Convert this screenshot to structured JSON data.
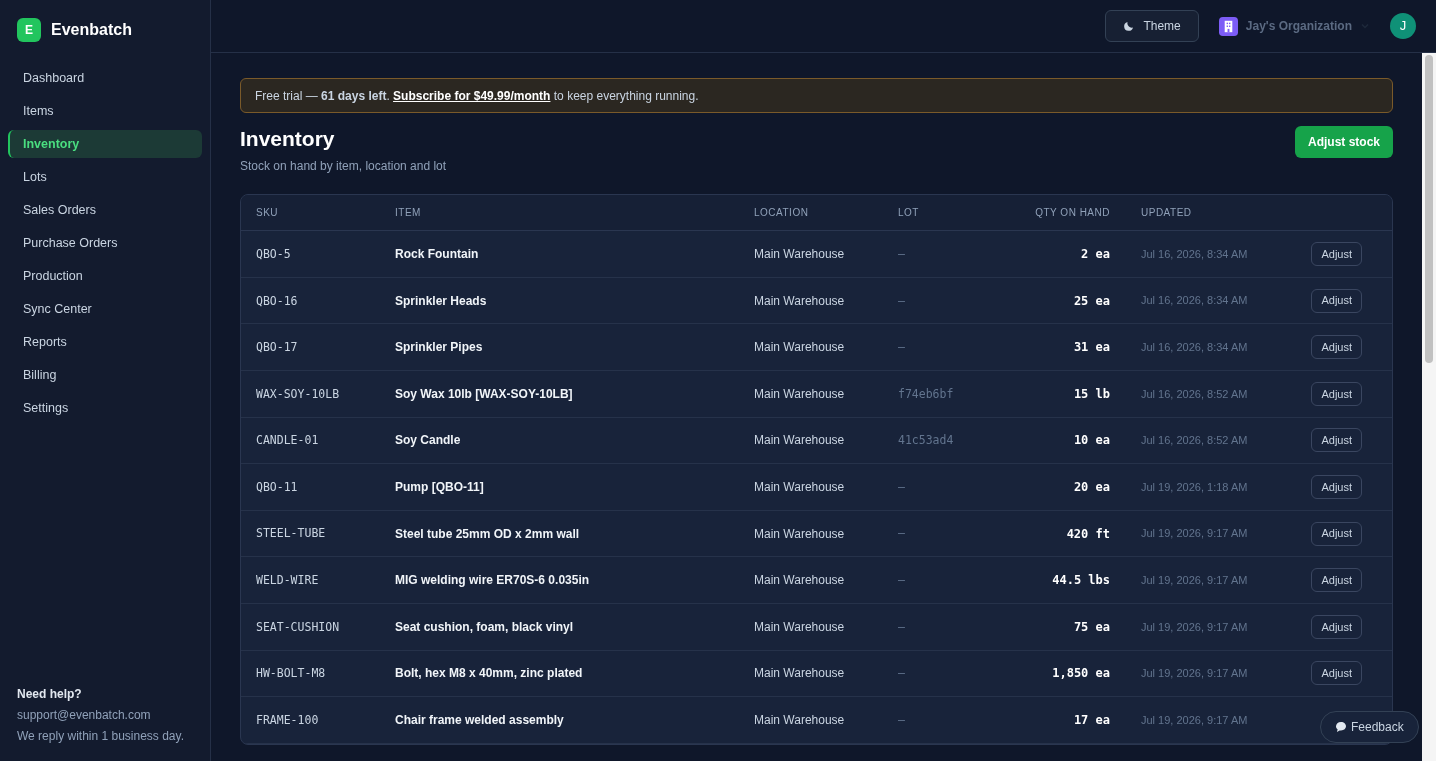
{
  "brand": {
    "logo_letter": "E",
    "name": "Evenbatch"
  },
  "nav": [
    {
      "label": "Dashboard",
      "selected": false
    },
    {
      "label": "Items",
      "selected": false
    },
    {
      "label": "Inventory",
      "selected": true
    },
    {
      "label": "Lots",
      "selected": false
    },
    {
      "label": "Sales Orders",
      "selected": false
    },
    {
      "label": "Purchase Orders",
      "selected": false
    },
    {
      "label": "Production",
      "selected": false
    },
    {
      "label": "Sync Center",
      "selected": false
    },
    {
      "label": "Reports",
      "selected": false
    },
    {
      "label": "Billing",
      "selected": false
    },
    {
      "label": "Settings",
      "selected": false
    }
  ],
  "help": {
    "title": "Need help?",
    "email": "support@evenbatch.com",
    "note": "We reply within 1 business day."
  },
  "header": {
    "theme_button": "Theme",
    "organization": "Jay's Organization",
    "avatar_letter": "J"
  },
  "banner": {
    "text": "Free trial — **61 days left**.",
    "link": "Subscribe for $49.99/month",
    "after": "to keep everything running."
  },
  "page": {
    "title": "Inventory",
    "subtitle": "Stock on hand by item, location and lot",
    "action": "Adjust stock"
  },
  "table": {
    "columns": [
      "SKU",
      "ITEM",
      "LOCATION",
      "LOT",
      "QTY ON HAND",
      "UPDATED"
    ],
    "rows": [
      {
        "sku": "QBO-5",
        "item": "Rock Fountain",
        "location": "Main Warehouse",
        "lot": "—",
        "qty": "2",
        "unit": "ea",
        "updated": "Jul 16, 2026, 8:34 AM",
        "action": "Adjust"
      },
      {
        "sku": "QBO-16",
        "item": "Sprinkler Heads",
        "location": "Main Warehouse",
        "lot": "—",
        "qty": "25",
        "unit": "ea",
        "updated": "Jul 16, 2026, 8:34 AM",
        "action": "Adjust"
      },
      {
        "sku": "QBO-17",
        "item": "Sprinkler Pipes",
        "location": "Main Warehouse",
        "lot": "—",
        "qty": "31",
        "unit": "ea",
        "updated": "Jul 16, 2026, 8:34 AM",
        "action": "Adjust"
      },
      {
        "sku": "WAX-SOY-10LB",
        "item": "Soy Wax 10lb [WAX-SOY-10LB]",
        "location": "Main Warehouse",
        "lot": "f74eb6bf",
        "qty": "15",
        "unit": "lb",
        "updated": "Jul 16, 2026, 8:52 AM",
        "action": "Adjust"
      },
      {
        "sku": "CANDLE-01",
        "item": "Soy Candle",
        "location": "Main Warehouse",
        "lot": "41c53ad4",
        "qty": "10",
        "unit": "ea",
        "updated": "Jul 16, 2026, 8:52 AM",
        "action": "Adjust"
      },
      {
        "sku": "QBO-11",
        "item": "Pump [QBO-11]",
        "location": "Main Warehouse",
        "lot": "—",
        "qty": "20",
        "unit": "ea",
        "updated": "Jul 19, 2026, 1:18 AM",
        "action": "Adjust"
      },
      {
        "sku": "STEEL-TUBE",
        "item": "Steel tube 25mm OD x 2mm wall",
        "location": "Main Warehouse",
        "lot": "—",
        "qty": "420",
        "unit": "ft",
        "updated": "Jul 19, 2026, 9:17 AM",
        "action": "Adjust"
      },
      {
        "sku": "WELD-WIRE",
        "item": "MIG welding wire ER70S-6 0.035in",
        "location": "Main Warehouse",
        "lot": "—",
        "qty": "44.5",
        "unit": "lbs",
        "updated": "Jul 19, 2026, 9:17 AM",
        "action": "Adjust"
      },
      {
        "sku": "SEAT-CUSHION",
        "item": "Seat cushion, foam, black vinyl",
        "location": "Main Warehouse",
        "lot": "—",
        "qty": "75",
        "unit": "ea",
        "updated": "Jul 19, 2026, 9:17 AM",
        "action": "Adjust"
      },
      {
        "sku": "HW-BOLT-M8",
        "item": "Bolt, hex M8 x 40mm, zinc plated",
        "location": "Main Warehouse",
        "lot": "—",
        "qty": "1,850",
        "unit": "ea",
        "updated": "Jul 19, 2026, 9:17 AM",
        "action": "Adjust"
      },
      {
        "sku": "FRAME-100",
        "item": "Chair frame welded assembly",
        "location": "Main Warehouse",
        "lot": "—",
        "qty": "17",
        "unit": "ea",
        "updated": "Jul 19, 2026, 9:17 AM"
      }
    ]
  },
  "feedback_button": "Feedback"
}
